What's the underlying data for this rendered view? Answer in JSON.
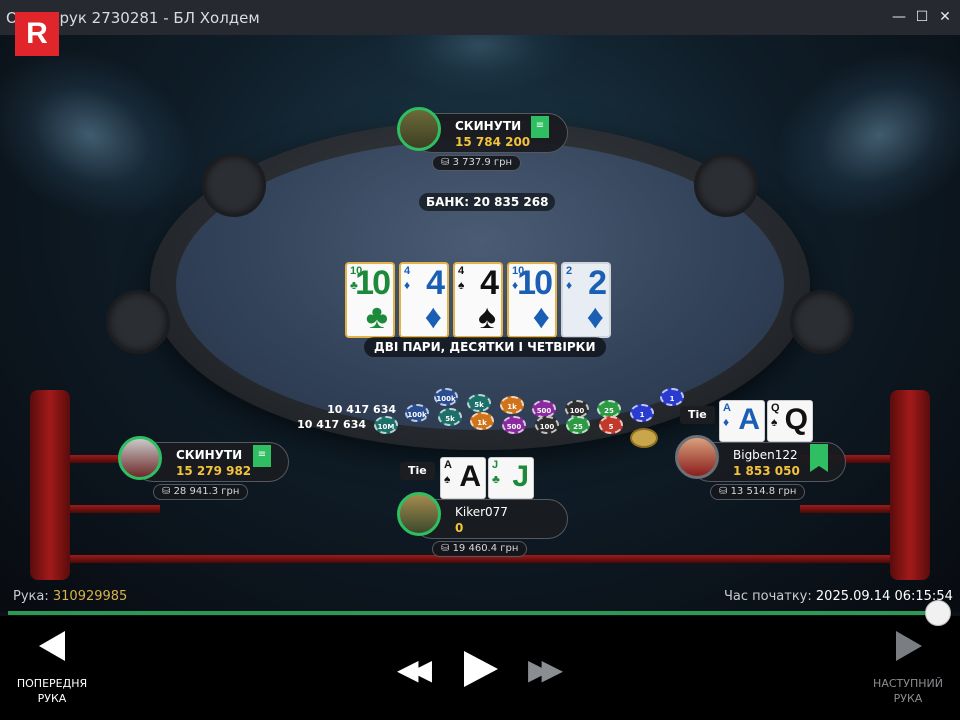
{
  "window": {
    "title": "Огляд рук 2730281 - БЛ Холдем",
    "minimize": "—",
    "maximize": "☐",
    "close": "✕"
  },
  "logo": "R",
  "pot": "БАНК: 20 835 268",
  "result": "ДВІ ПАРИ, ДЕСЯТКИ І ЧЕТВІРКИ",
  "board": [
    {
      "rank": "10",
      "suit": "♣",
      "color": "green"
    },
    {
      "rank": "4",
      "suit": "♦",
      "color": "blue"
    },
    {
      "rank": "4",
      "suit": "♠",
      "color": "black"
    },
    {
      "rank": "10",
      "suit": "♦",
      "color": "blue"
    },
    {
      "rank": "2",
      "suit": "♦",
      "color": "blue"
    }
  ],
  "players": {
    "top": {
      "name": "СКИНУТИ",
      "stack": "15 784 200",
      "cash": "3 737.9 грн"
    },
    "left": {
      "name": "СКИНУТИ",
      "stack": "15 279 982",
      "cash": "28 941.3 грн"
    },
    "hero": {
      "name": "Kiker077",
      "stack": "0",
      "cash": "19 460.4 грн",
      "tie": "Tie",
      "cards": [
        {
          "rank": "A",
          "suit": "♠",
          "color": "black"
        },
        {
          "rank": "J",
          "suit": "♣",
          "color": "green"
        }
      ]
    },
    "right": {
      "name": "Bigben122",
      "stack": "1 853 050",
      "cash": "13 514.8 грн",
      "tie": "Tie",
      "cards": [
        {
          "rank": "A",
          "suit": "♦",
          "color": "blue"
        },
        {
          "rank": "Q",
          "suit": "♠",
          "color": "black"
        }
      ]
    }
  },
  "chips": {
    "amount1": "10 417 634",
    "amount2": "10 417 634",
    "row1": [
      "100k",
      "5k",
      "1k",
      "500",
      "100",
      "25",
      "1"
    ],
    "row2": [
      "10M",
      "100k",
      "5k",
      "1k",
      "500",
      "100",
      "25",
      "5",
      "1"
    ]
  },
  "footer": {
    "hand_label": "Рука:",
    "hand_value": "310929985",
    "start_label": "Час початку:",
    "start_value": "2025.09.14 06:15:54"
  },
  "controls": {
    "prev_label": "ПОПЕРЕДНЯ РУКА",
    "next_label": "НАСТУПНИЙ РУКА"
  },
  "timeline_progress": 1.0
}
